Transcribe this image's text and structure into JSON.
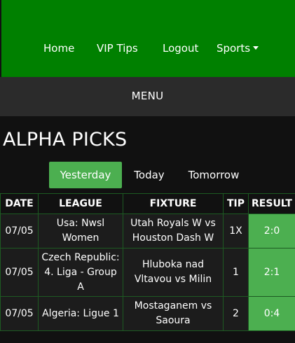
{
  "nav": {
    "home": "Home",
    "vip_tips": "VIP Tips",
    "logout": "Logout",
    "sports": "Sports"
  },
  "menu": {
    "label": "MENU"
  },
  "page": {
    "title": "ALPHA PICKS"
  },
  "tabs": [
    {
      "label": "Yesterday",
      "active": true
    },
    {
      "label": "Today",
      "active": false
    },
    {
      "label": "Tomorrow",
      "active": false
    }
  ],
  "table": {
    "headers": [
      "DATE",
      "LEAGUE",
      "FIXTURE",
      "TIP",
      "RESULT"
    ],
    "rows": [
      {
        "date": "07/05",
        "league": "Usa: Nwsl Women",
        "fixture": "Utah Royals W vs Houston Dash W",
        "tip": "1X",
        "result": "2:0"
      },
      {
        "date": "07/05",
        "league": "Czech Republic: 4. Liga - Group A",
        "fixture": "Hluboka nad Vltavou vs Milin",
        "tip": "1",
        "result": "2:1"
      },
      {
        "date": "07/05",
        "league": "Algeria: Ligue 1",
        "fixture": "Mostaganem vs Saoura",
        "tip": "2",
        "result": "0:4"
      }
    ]
  },
  "colors": {
    "topbar": "#008000",
    "menubar": "#2b2b2b",
    "background": "#111111",
    "accent": "#4caf50",
    "table_border": "#1d5a22"
  }
}
